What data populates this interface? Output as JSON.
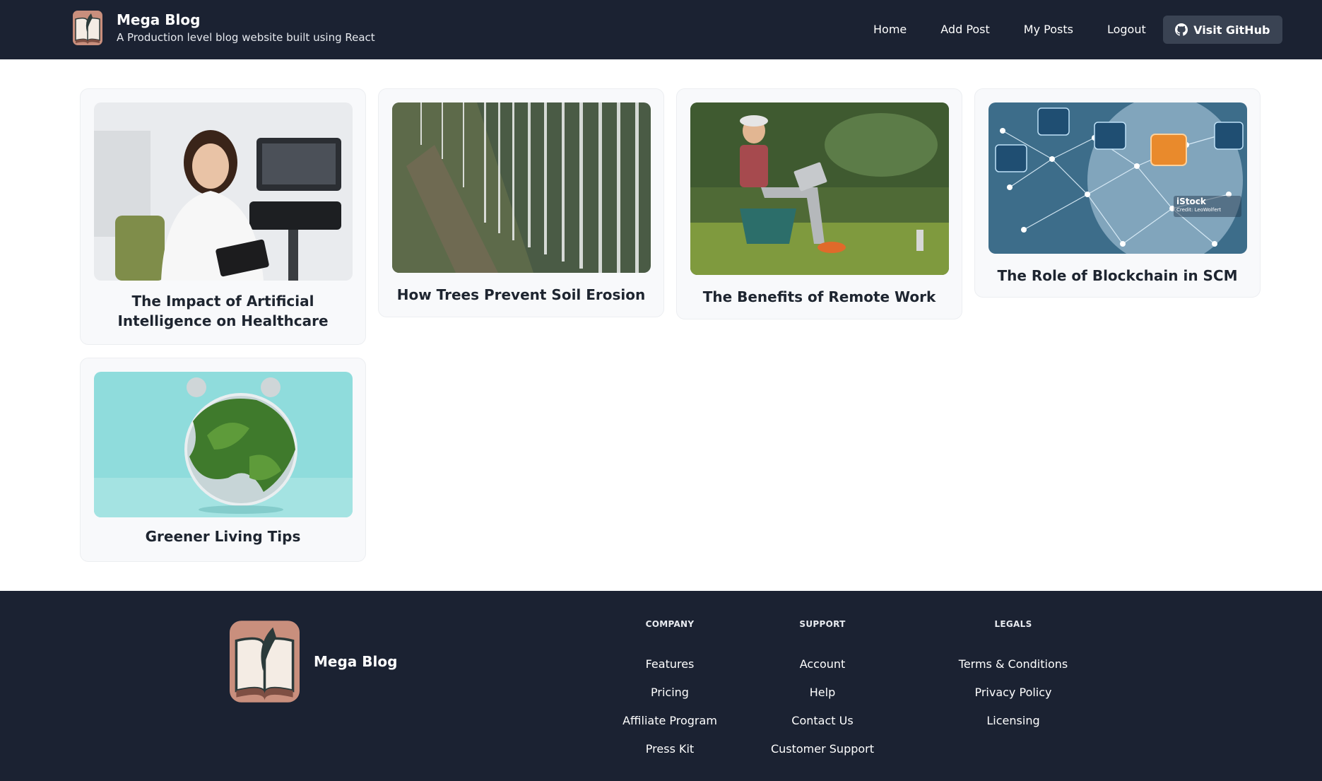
{
  "header": {
    "title": "Mega Blog",
    "subtitle": "A Production level blog website built using React",
    "nav": [
      "Home",
      "Add Post",
      "My Posts",
      "Logout"
    ],
    "github_label": "Visit GitHub"
  },
  "posts": [
    {
      "title": "The Impact of Artificial Intelligence on Healthcare"
    },
    {
      "title": "How Trees Prevent Soil Erosion"
    },
    {
      "title": "The Benefits of Remote Work"
    },
    {
      "title": "The Role of Blockchain in SCM"
    },
    {
      "title": "Greener Living Tips"
    }
  ],
  "image_overlay": {
    "istock": "iStock",
    "credit": "Credit: LeoWolfert"
  },
  "footer": {
    "brand": "Mega Blog",
    "columns": [
      {
        "heading": "COMPANY",
        "links": [
          "Features",
          "Pricing",
          "Affiliate Program",
          "Press Kit"
        ]
      },
      {
        "heading": "SUPPORT",
        "links": [
          "Account",
          "Help",
          "Contact Us",
          "Customer Support"
        ]
      },
      {
        "heading": "LEGALS",
        "links": [
          "Terms & Conditions",
          "Privacy Policy",
          "Licensing"
        ]
      }
    ]
  },
  "colors": {
    "nav_bg": "#1b2232",
    "button_bg": "#3a4353",
    "card_bg": "#f8f9fb",
    "logo_accent": "#c98f7d"
  }
}
